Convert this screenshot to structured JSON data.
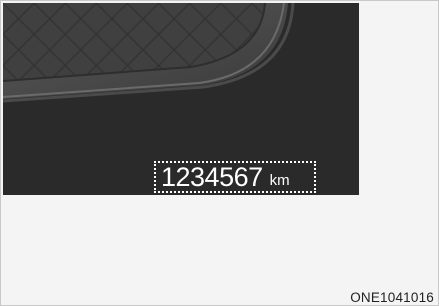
{
  "odometer": {
    "value": "1234567",
    "unit": "km"
  },
  "figure_code": "ONE1041016",
  "colors": {
    "panel_background": "#2a2a2a",
    "display_text": "#ffffff",
    "page_background": "#f4f4f4"
  }
}
